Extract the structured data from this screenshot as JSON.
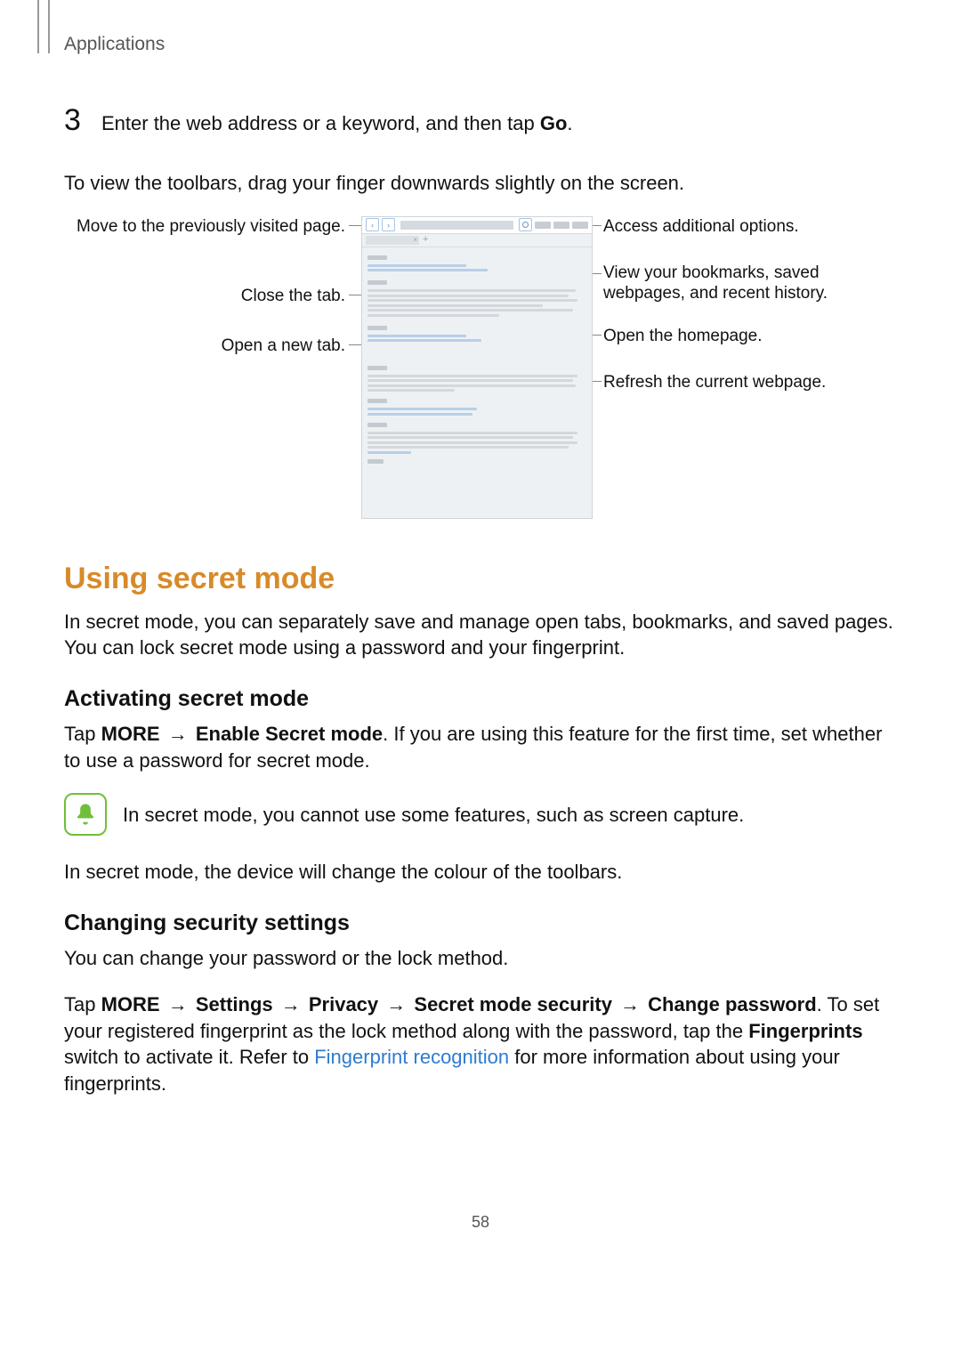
{
  "header": "Applications",
  "page_number": "58",
  "step": {
    "number": "3",
    "text_before": "Enter the web address or a keyword, and then tap ",
    "go": "Go",
    "text_after": "."
  },
  "toolbars_hint": "To view the toolbars, drag your finger downwards slightly on the screen.",
  "callouts": {
    "left1": "Move to the previously visited page.",
    "left2": "Close the tab.",
    "left3": "Open a new tab.",
    "right1": "Access additional options.",
    "right2": "View your bookmarks, saved webpages, and recent history.",
    "right3": "Open the homepage.",
    "right4": "Refresh the current webpage."
  },
  "section": {
    "title": "Using secret mode",
    "desc": "In secret mode, you can separately save and manage open tabs, bookmarks, and saved pages. You can lock secret mode using a password and your fingerprint."
  },
  "activate": {
    "title": "Activating secret mode",
    "pre": "Tap ",
    "more": "MORE",
    "arrow": " → ",
    "enable": "Enable Secret mode",
    "post": ". If you are using this feature for the first time, set whether to use a password for secret mode."
  },
  "note": "In secret mode, you cannot use some features, such as screen capture.",
  "colour_note": "In secret mode, the device will change the colour of the toolbars.",
  "change": {
    "title": "Changing security settings",
    "line1": "You can change your password or the lock method.",
    "pre": "Tap ",
    "more": "MORE",
    "arrow": " → ",
    "settings": "Settings",
    "privacy": "Privacy",
    "sms": "Secret mode security",
    "cpw": "Change password",
    "post1": ". To set your registered fingerprint as the lock method along with the password, tap the ",
    "fp": "Fingerprints",
    "post2": " switch to activate it. Refer to ",
    "link": "Fingerprint recognition",
    "post3": " for more information about using your fingerprints."
  }
}
